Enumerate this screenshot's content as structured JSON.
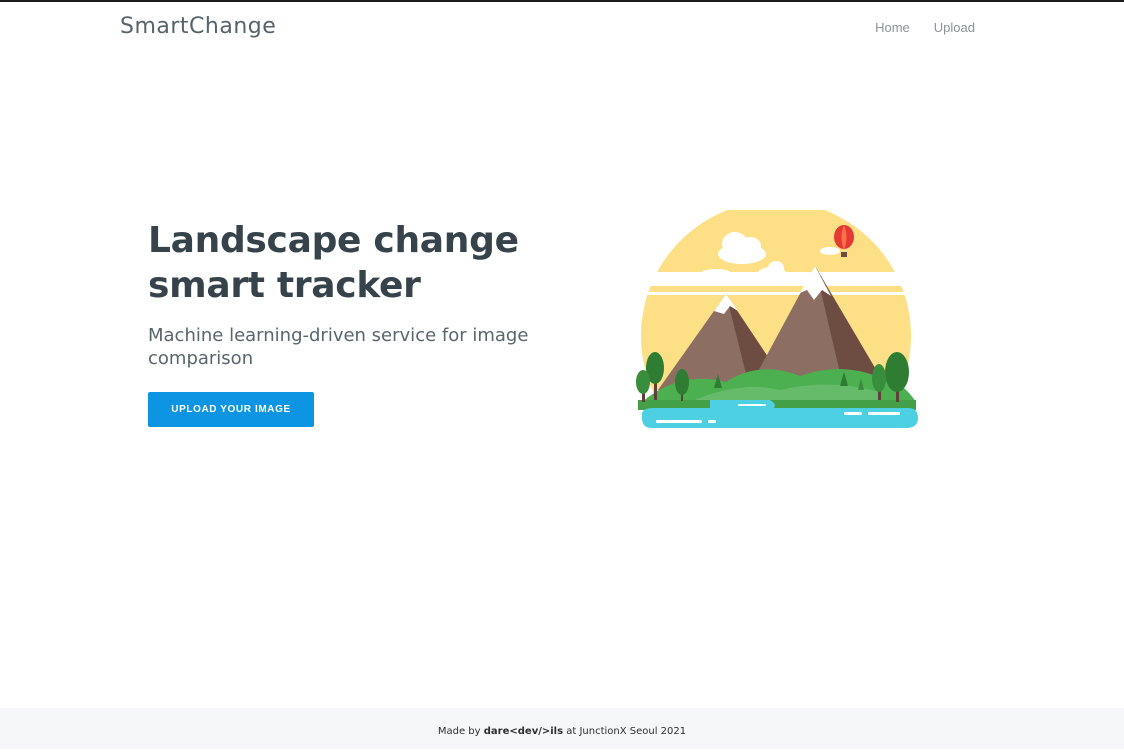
{
  "navbar": {
    "brand": "SmartChange",
    "links": [
      {
        "label": "Home"
      },
      {
        "label": "Upload"
      }
    ]
  },
  "hero": {
    "title_line1": "Landscape change",
    "title_line2": "smart tracker",
    "subtitle": "Machine learning-driven service for image comparison",
    "cta_label": "UPLOAD YOUR IMAGE"
  },
  "illustration": {
    "icon": "landscape-mountains-balloon-illustration"
  },
  "footer": {
    "prefix": "Made by",
    "team": "dare<dev/>ils",
    "suffix": "at JunctionX Seoul 2021"
  },
  "colors": {
    "primary": "#0d95e3",
    "text": "#37434b",
    "footer_bg": "#f6f7f8"
  }
}
